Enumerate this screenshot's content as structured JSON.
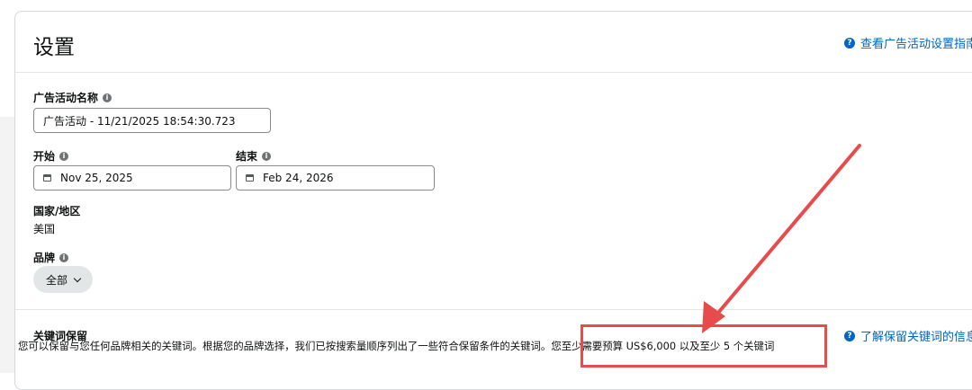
{
  "header": {
    "title": "设置",
    "help_link": "查看广告活动设置指南"
  },
  "campaign_name": {
    "label": "广告活动名称",
    "value": "广告活动 - 11/21/2025 18:54:30.723"
  },
  "start": {
    "label": "开始",
    "value": "Nov 25, 2025"
  },
  "end": {
    "label": "结束",
    "value": "Feb 24, 2026"
  },
  "country": {
    "label": "国家/地区",
    "value": "美国"
  },
  "brand": {
    "label": "品牌",
    "selected": "全部"
  },
  "keyword_retention": {
    "title": "关键词保留",
    "help_link": "了解保留关键词的信息",
    "description": "您可以保留与您任何品牌相关的关键词。根据您的品牌选择，我们已按搜索量顺序列出了一些符合保留条件的关键词。您至少需要预算 US$6,000 以及至少 5 个关键词"
  },
  "icons": {
    "info": "info-icon",
    "help": "question-icon",
    "calendar": "calendar-icon",
    "dropdown": "chevron-down-icon"
  },
  "colors": {
    "link": "#0066c0",
    "annotation": "#e84b4b"
  }
}
